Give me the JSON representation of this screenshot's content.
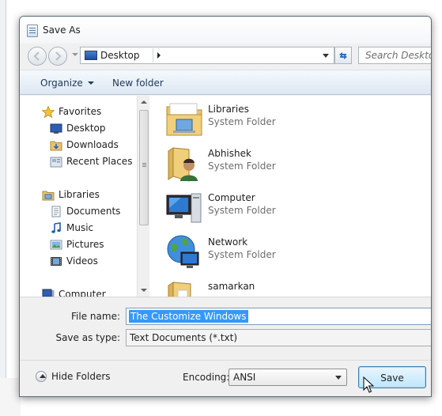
{
  "window": {
    "title": "Save As"
  },
  "navigation": {
    "address": "Desktop",
    "search_placeholder": "Search Desktop"
  },
  "toolbar": {
    "organize": "Organize",
    "new_folder": "New folder"
  },
  "nav_pane": {
    "favorites": {
      "label": "Favorites",
      "items": [
        "Desktop",
        "Downloads",
        "Recent Places"
      ]
    },
    "libraries": {
      "label": "Libraries",
      "items": [
        "Documents",
        "Music",
        "Pictures",
        "Videos"
      ]
    },
    "computer": {
      "label": "Computer"
    }
  },
  "files": [
    {
      "name": "Libraries",
      "type": "System Folder",
      "icon": "libraries-folder-icon"
    },
    {
      "name": "Abhishek",
      "type": "System Folder",
      "icon": "user-folder-icon"
    },
    {
      "name": "Computer",
      "type": "System Folder",
      "icon": "computer-icon"
    },
    {
      "name": "Network",
      "type": "System Folder",
      "icon": "network-icon"
    },
    {
      "name": "samarkan",
      "type": "",
      "icon": "folder-icon"
    }
  ],
  "form": {
    "file_name_label": "File name:",
    "file_name_value": "The Customize Windows",
    "save_as_type_label": "Save as type:",
    "save_as_type_value": "Text Documents (*.txt)"
  },
  "footer": {
    "hide_folders": "Hide Folders",
    "encoding_label": "Encoding:",
    "encoding_value": "ANSI",
    "save_button": "Save"
  }
}
